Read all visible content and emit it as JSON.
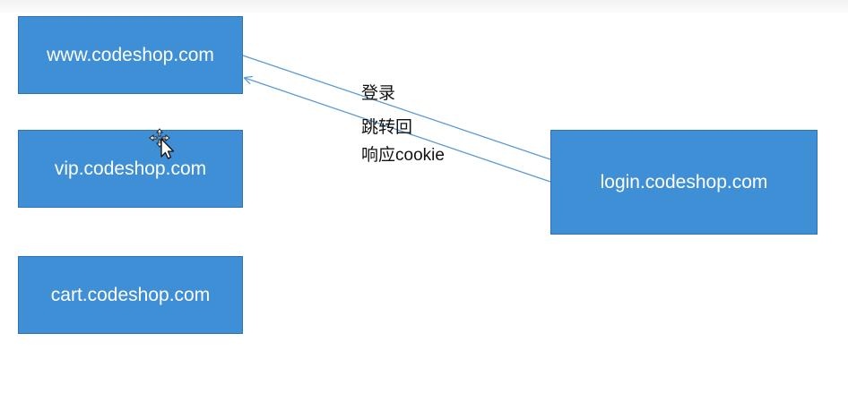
{
  "diagram": {
    "nodes": {
      "www": {
        "label": "www.codeshop.com"
      },
      "vip": {
        "label": "vip.codeshop.com"
      },
      "cart": {
        "label": "cart.codeshop.com"
      },
      "login": {
        "label": "login.codeshop.com"
      }
    },
    "edges": [
      {
        "from": "www",
        "to": "login"
      },
      {
        "from": "login",
        "to": "www"
      }
    ],
    "annotations": {
      "login": "登录",
      "redirect_back": "跳转回",
      "respond_cookie": "响应cookie"
    },
    "colors": {
      "node_fill": "#3f8fd6",
      "node_border": "#2f73b4",
      "node_text": "#ffffff",
      "edge": "#5b9bd5"
    }
  },
  "cursor_icon": "move-cursor-icon"
}
